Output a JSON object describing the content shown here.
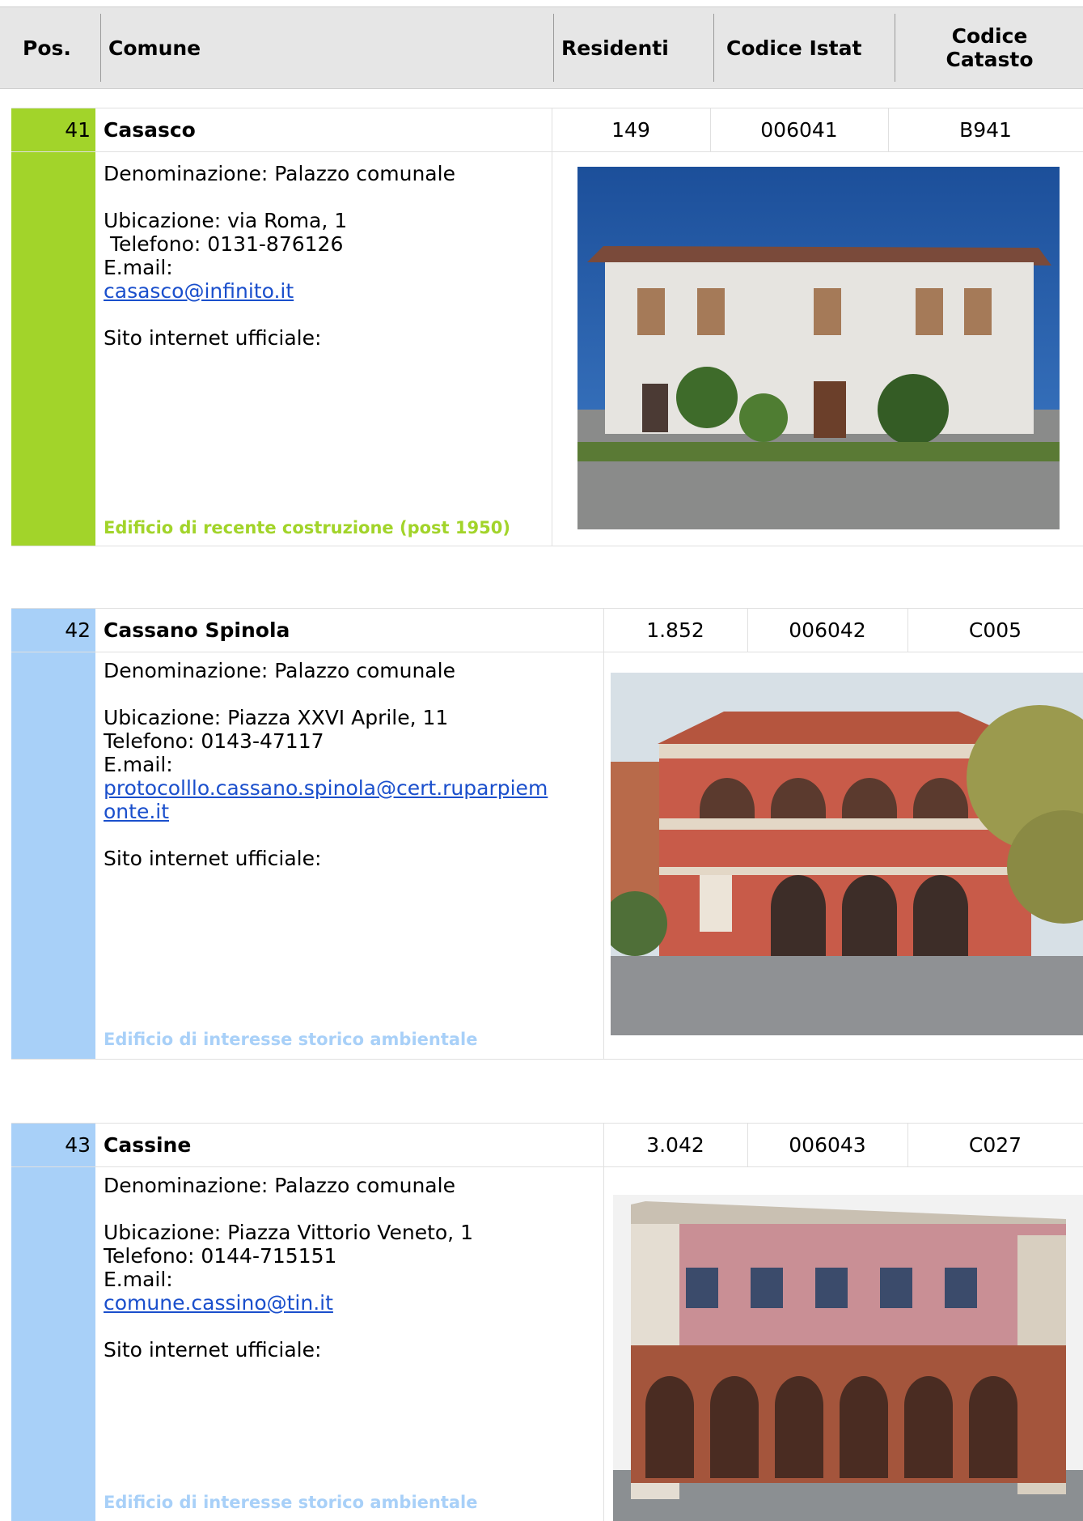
{
  "header": {
    "pos": "Pos.",
    "comune": "Comune",
    "residenti": "Residenti",
    "codice_istat": "Codice Istat",
    "codice_catasto_1": "Codice",
    "codice_catasto_2": "Catasto"
  },
  "colors": {
    "green": "#a2d42a",
    "blue": "#a8d0f8",
    "link": "#1a4fcc"
  },
  "entries": [
    {
      "pos": "41",
      "name": "Casasco",
      "residenti": "149",
      "istat": "006041",
      "catasto": "B941",
      "denominazione": "Denominazione: Palazzo comunale",
      "ubicazione": "Ubicazione: via Roma, 1",
      "telefono": " Telefono: 0131-876126",
      "email_label": "E.mail:",
      "email": "casasco@infinito.it",
      "sito": "Sito internet ufficiale:",
      "note": "Edificio di recente costruzione (post 1950)"
    },
    {
      "pos": "42",
      "name": "Cassano Spinola",
      "residenti": "1.852",
      "istat": "006042",
      "catasto": "C005",
      "denominazione": "Denominazione: Palazzo comunale",
      "ubicazione": "Ubicazione: Piazza XXVI Aprile, 11",
      "telefono": "Telefono: 0143-47117",
      "email_label": "E.mail:",
      "email_1": "protocolllo.cassano.spinola@cert.ruparpiem",
      "email_2": "onte.it",
      "sito": "Sito internet ufficiale:",
      "note": "Edificio di interesse storico ambientale"
    },
    {
      "pos": "43",
      "name": "Cassine",
      "residenti": "3.042",
      "istat": "006043",
      "catasto": "C027",
      "denominazione": "Denominazione: Palazzo comunale",
      "ubicazione": "Ubicazione: Piazza Vittorio Veneto, 1",
      "telefono": "Telefono: 0144-715151",
      "email_label": "E.mail:",
      "email": "comune.cassino@tin.it",
      "sito": "Sito internet ufficiale:",
      "note": "Edificio di interesse storico ambientale"
    }
  ]
}
